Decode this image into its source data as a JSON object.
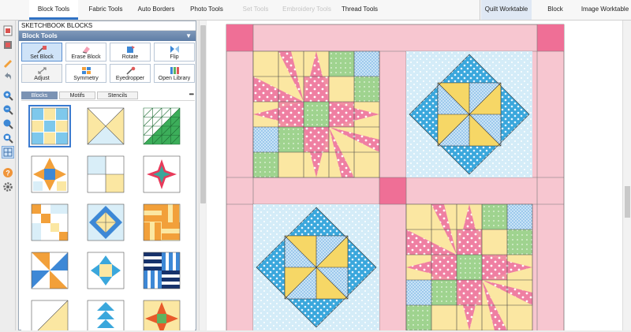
{
  "ribbon": {
    "tabs": [
      {
        "label": "Block Tools",
        "state": "active"
      },
      {
        "label": "Fabric Tools",
        "state": "normal"
      },
      {
        "label": "Auto Borders",
        "state": "normal"
      },
      {
        "label": "Photo Tools",
        "state": "normal"
      },
      {
        "label": "Set Tools",
        "state": "disabled"
      },
      {
        "label": "Embroidery Tools",
        "state": "disabled"
      },
      {
        "label": "Thread Tools",
        "state": "normal"
      }
    ],
    "worktables": [
      {
        "label": "Quilt Worktable",
        "state": "active"
      },
      {
        "label": "Block Worktable",
        "state": "normal"
      },
      {
        "label": "Image Worktable",
        "state": "normal"
      }
    ]
  },
  "left_toolbar": {
    "icons": [
      "file-icon",
      "sketchbook-icon",
      "pencil-icon",
      "undo-icon",
      "zoom-in-icon",
      "zoom-out-icon",
      "zoom-fit-icon",
      "zoom-area-icon",
      "grid-icon",
      "help-icon",
      "settings-icon"
    ]
  },
  "palette": {
    "title": "SKETCHBOOK BLOCKS",
    "section": "Block Tools",
    "buttons": [
      {
        "label": "Set Block",
        "icon": "set-block-icon",
        "selected": true
      },
      {
        "label": "Erase Block",
        "icon": "erase-block-icon",
        "selected": false
      },
      {
        "label": "Rotate",
        "icon": "rotate-icon",
        "selected": false
      },
      {
        "label": "Flip",
        "icon": "flip-icon",
        "selected": false
      },
      {
        "label": "Adjust",
        "icon": "adjust-icon",
        "selected": false
      },
      {
        "label": "Symmetry",
        "icon": "symmetry-icon",
        "selected": false
      },
      {
        "label": "Eyedropper",
        "icon": "eyedropper-icon",
        "selected": false
      },
      {
        "label": "Open Library",
        "icon": "open-library-icon",
        "selected": false
      }
    ],
    "tabs": [
      {
        "label": "Blocks",
        "state": "active"
      },
      {
        "label": "Motifs",
        "state": "normal"
      },
      {
        "label": "Stencils",
        "state": "normal"
      }
    ],
    "more": "•••"
  },
  "colors": {
    "pink": "#f7c6d0",
    "hot_pink": "#ef6f96",
    "yellow": "#fbe7a2",
    "light_blue": "#d9eef8",
    "blue": "#3aa7dc",
    "green": "#a2d495",
    "accent": "#2f72c4"
  }
}
